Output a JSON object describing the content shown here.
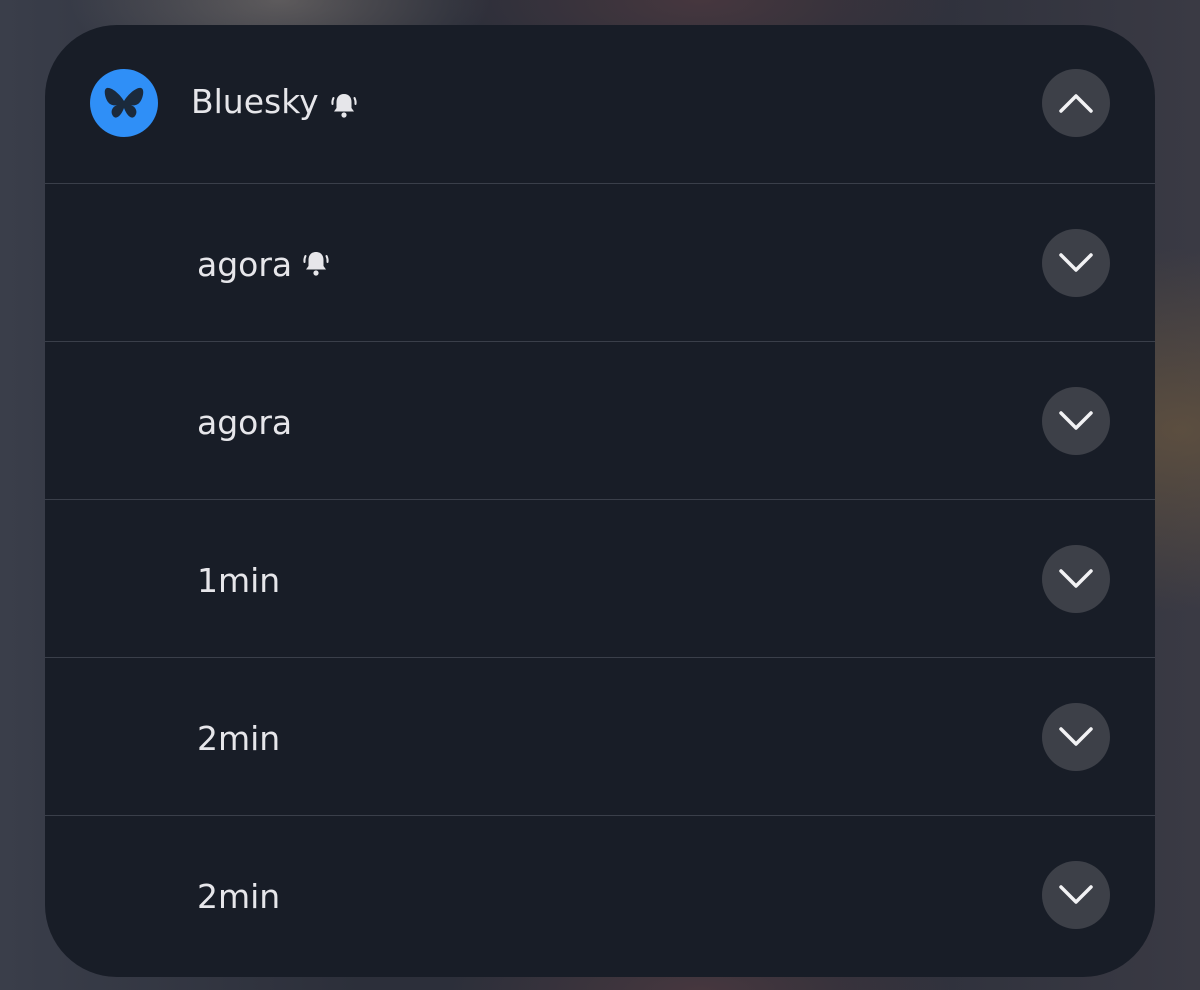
{
  "app": {
    "name": "Bluesky",
    "icon": "bluesky-butterfly-icon",
    "icon_bg": "#2f8ff7",
    "header_bell_icon": "bell-alert-icon",
    "header_toggle_icon": "chevron-up-icon"
  },
  "notifications": [
    {
      "time": "agora",
      "bell": true,
      "toggle_icon": "chevron-down-icon"
    },
    {
      "time": "agora",
      "bell": false,
      "toggle_icon": "chevron-down-icon"
    },
    {
      "time": "1min",
      "bell": false,
      "toggle_icon": "chevron-down-icon"
    },
    {
      "time": "2min",
      "bell": false,
      "toggle_icon": "chevron-down-icon"
    },
    {
      "time": "2min",
      "bell": false,
      "toggle_icon": "chevron-down-icon"
    }
  ]
}
